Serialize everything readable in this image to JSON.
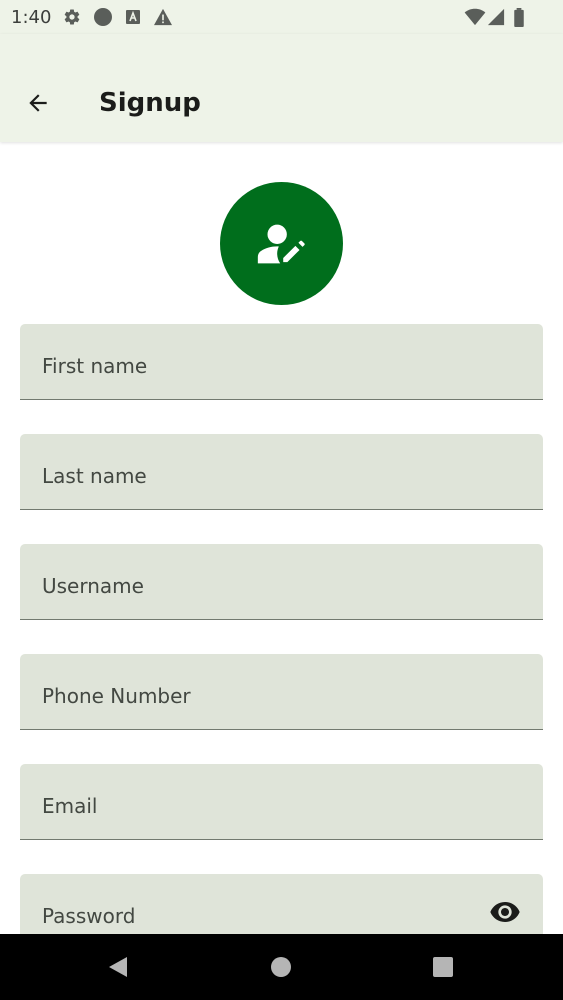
{
  "status_bar": {
    "time": "1:40",
    "left_icons": [
      "gear-icon",
      "circle-icon",
      "font-a-icon",
      "warning-icon"
    ],
    "right_icons": [
      "wifi-icon",
      "cell-signal-icon",
      "battery-icon"
    ]
  },
  "app_bar": {
    "title": "Signup",
    "back_icon": "arrow-left-icon"
  },
  "avatar": {
    "icon": "person-edit-icon",
    "color": "#006e1c"
  },
  "form": {
    "fields": [
      {
        "label": "First name"
      },
      {
        "label": "Last name"
      },
      {
        "label": "Username"
      },
      {
        "label": "Phone Number"
      },
      {
        "label": "Email"
      },
      {
        "label": "Password",
        "trailing_icon": "eye-icon"
      }
    ]
  },
  "nav_bar": {
    "buttons": [
      "back-triangle-icon",
      "home-circle-icon",
      "recents-square-icon"
    ]
  },
  "colors": {
    "bar_background": "#eef3e8",
    "field_background": "#dfe4d9",
    "accent": "#006e1c"
  }
}
